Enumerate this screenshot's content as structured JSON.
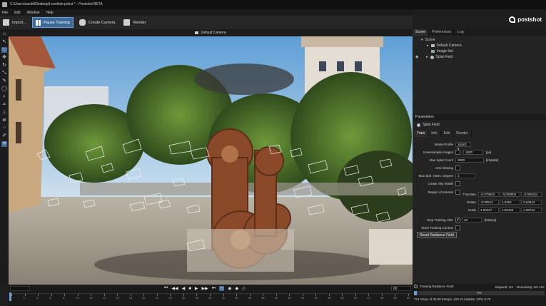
{
  "window": {
    "title": "C:\\Users\\sachit\\Desktop\\Loveliste.pshot * - Postshot BETA"
  },
  "menu": [
    "File",
    "Edit",
    "Window",
    "Help"
  ],
  "toolbar": {
    "import": "Import...",
    "pause_training": "Pause Training",
    "create_camera": "Create Camera",
    "render": "Render"
  },
  "brand": {
    "name": "postshot"
  },
  "viewport": {
    "camera": "Default Camera"
  },
  "scene_tabs": [
    "Scene",
    "Preferences",
    "Log"
  ],
  "scene_tree": [
    {
      "label": "Scene",
      "indent": 0
    },
    {
      "label": "Default Camera",
      "indent": 1
    },
    {
      "label": "Image Set",
      "indent": 1
    },
    {
      "label": "Splat Field",
      "indent": 1
    }
  ],
  "params": {
    "title": "Parameters",
    "object": "Splat Field",
    "tabs": [
      "Train",
      "Info",
      "Edit",
      "Render"
    ],
    "model_profile_label": "Model Profile",
    "model_profile": "Splat3",
    "downsample_label": "Downsample Images",
    "downsample_value": "1600",
    "downsample_unit": "[px]",
    "max_splat_label": "Max Splat Count",
    "max_splat_value": "3000",
    "max_splat_unit": "[kSplats]",
    "anti_alias_label": "Anti-Aliasing",
    "max_sph_label": "Max Sph. Harm. Degree",
    "max_sph_value": "3",
    "sky_label": "Create Sky Model",
    "roi_label": "Region of Interest",
    "translate_label": "Translate",
    "translate": [
      "-0.079603",
      "-0.008806",
      "-0.095154"
    ],
    "rotate_label": "Rotate",
    "rotate": [
      "-0.00512",
      "1.5392",
      "0.54942"
    ],
    "scale_label": "Scale",
    "scale": [
      "1.00427",
      "1.82443",
      "1.09734"
    ],
    "stop_label": "Stop Training After",
    "stop_value": "40",
    "stop_unit": "[kSteps]",
    "store_label": "Store Training Context",
    "reset_button": "Reset Radiance Field"
  },
  "status": {
    "task": "Training Radiance Field",
    "elapsed": "Elapsed: 4m",
    "remaining": "Remaining: 9m 10s",
    "progress_label": "2%",
    "progress": 0.02,
    "detail": "724 Steps of 30.00 kSteps, 229.15 kSplats, GPU 0.75"
  },
  "timeline": {
    "start": "0",
    "end": "60",
    "ticks": [
      "0",
      "2",
      "4",
      "6",
      "8",
      "10",
      "12",
      "14",
      "16",
      "18",
      "20",
      "22",
      "24",
      "26",
      "28",
      "30",
      "32",
      "34",
      "36",
      "38",
      "40",
      "42",
      "44",
      "46",
      "48",
      "50",
      "52",
      "54",
      "56",
      "58",
      "60"
    ]
  },
  "colors": {
    "accent": "#3e6a9a",
    "sky": "#8fb9dc",
    "ground": "#b7ad9c"
  }
}
